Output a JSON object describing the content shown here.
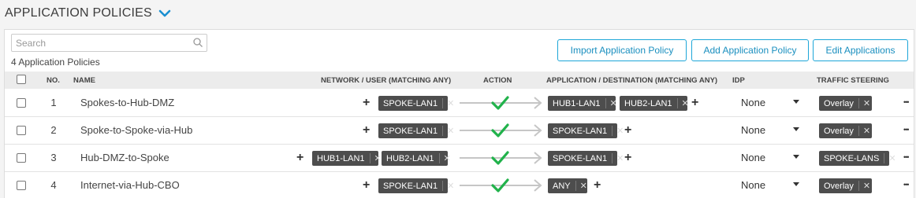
{
  "page": {
    "title": "APPLICATION POLICIES"
  },
  "toolbar": {
    "search_placeholder": "Search",
    "count_label": "4 Application Policies",
    "import_label": "Import Application Policy",
    "add_label": "Add Application Policy",
    "edit_label": "Edit Applications"
  },
  "table": {
    "headers": {
      "no": "NO.",
      "name": "NAME",
      "network": "NETWORK / USER (MATCHING ANY)",
      "action": "ACTION",
      "application": "APPLICATION / DESTINATION (MATCHING ANY)",
      "idp": "IDP",
      "steering": "TRAFFIC STEERING"
    },
    "rows": [
      {
        "no": "1",
        "name": "Spokes-to-Hub-DMZ",
        "network": [
          "SPOKE-LAN1"
        ],
        "apps": [
          "HUB1-LAN1",
          "HUB2-LAN1"
        ],
        "idp": "None",
        "steering": "Overlay"
      },
      {
        "no": "2",
        "name": "Spoke-to-Spoke-via-Hub",
        "network": [
          "SPOKE-LAN1"
        ],
        "apps": [
          "SPOKE-LAN1"
        ],
        "idp": "None",
        "steering": "Overlay"
      },
      {
        "no": "3",
        "name": "Hub-DMZ-to-Spoke",
        "network": [
          "HUB1-LAN1",
          "HUB2-LAN1"
        ],
        "apps": [
          "SPOKE-LAN1"
        ],
        "idp": "None",
        "steering": "SPOKE-LANS"
      },
      {
        "no": "4",
        "name": "Internet-via-Hub-CBO",
        "network": [
          "SPOKE-LAN1"
        ],
        "apps": [
          "ANY"
        ],
        "idp": "None",
        "steering": "Overlay"
      }
    ]
  },
  "colors": {
    "accent": "#1da6d8",
    "check": "#21b24b",
    "tag": "#4d4d4d"
  },
  "icons": {
    "header": "chevron-down-icon",
    "search": "search-icon",
    "action": "check-arrow-icon",
    "more": "more-icon"
  }
}
